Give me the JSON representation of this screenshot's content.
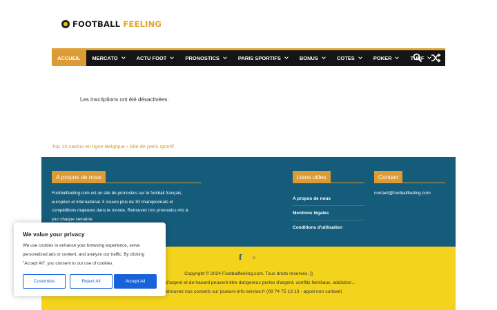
{
  "logo": {
    "word1": "FOOTBALL",
    "word2": "FEELING"
  },
  "nav": {
    "items": [
      {
        "label": "ACCUEIL",
        "active": true,
        "dropdown": false
      },
      {
        "label": "MERCATO",
        "dropdown": true
      },
      {
        "label": "ACTU FOOT",
        "dropdown": true
      },
      {
        "label": "PRONOSTICS",
        "dropdown": true
      },
      {
        "label": "PARIS SPORTIFS",
        "dropdown": true
      },
      {
        "label": "BONUS",
        "dropdown": true
      },
      {
        "label": "COTES",
        "dropdown": true
      },
      {
        "label": "POKER",
        "dropdown": true
      },
      {
        "label": "TURF",
        "dropdown": true
      }
    ],
    "icons": [
      "search-icon",
      "shuffle-icon"
    ]
  },
  "main": {
    "message": "Les inscriptions ont été désactivées.",
    "link1": "Top 10 casino en ligne Belgique",
    "separator": " - ",
    "link2": "Site de paris sportif"
  },
  "footer": {
    "about_title": "A propos de nous",
    "about_lines": [
      "Footballfeeling.com est un site de pronostics sur le football français,",
      "européen et international. Il couvre plus de 30 championnats et",
      "compétitions majeures dans le monde. Retrouvez nos pronostics mis à",
      "jour chaque semaine."
    ],
    "liens_title": "Liens utiles",
    "liens": [
      "A propos de nous",
      "Mentions légales",
      "Conditions d'utilisation"
    ],
    "contact_title": "Contact",
    "contact_email": "contact@footballfeeling.com",
    "social_icons": [
      "facebook-icon",
      "x-icon"
    ],
    "copyright": "Copyright © 2024 Footballfeeling.com. Tous droits réservés. []",
    "warning_line1": "d'argent et de hasard peuvent être dangereux pertes d'argent, conflits familiaux, addiction…",
    "warning_line2": "etrouvez nos conseils sur joueurs-info-service.fr (09 74 75 13 13 - appel non surtaxé)"
  },
  "cookie": {
    "title": "We value your privacy",
    "text_lines": [
      "We use cookies to enhance your browsing experience, serve",
      "personalized ads or content, and analyze our traffic. By clicking",
      "\"Accept All\", you consent to our use of cookies."
    ],
    "customize": "Customize",
    "reject": "Reject All",
    "accept": "Accept All"
  },
  "colors": {
    "accent": "#dc9b35",
    "nav_bg": "#151515",
    "footer_blue": "#155c7a",
    "footer_yellow": "#f3d31c",
    "cookie_button": "#1863dc"
  }
}
